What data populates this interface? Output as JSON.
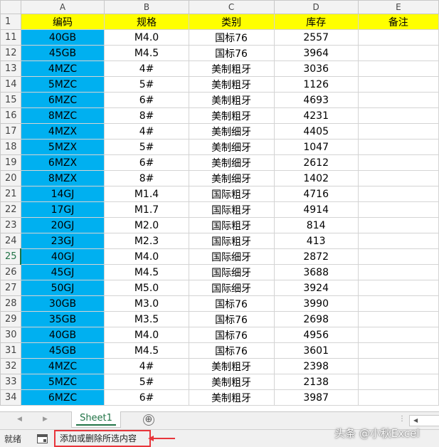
{
  "columns": {
    "a": "A",
    "b": "B",
    "c": "C",
    "d": "D",
    "e": "E"
  },
  "header_row": {
    "row": "1",
    "a": "编码",
    "b": "规格",
    "c": "类别",
    "d": "库存",
    "e": "备注"
  },
  "rows": [
    {
      "row": "11",
      "a": "40GB",
      "b": "M4.0",
      "c": "国标76",
      "d": "2557"
    },
    {
      "row": "12",
      "a": "45GB",
      "b": "M4.5",
      "c": "国标76",
      "d": "3964"
    },
    {
      "row": "13",
      "a": "4MZC",
      "b": "4#",
      "c": "美制粗牙",
      "d": "3036"
    },
    {
      "row": "14",
      "a": "5MZC",
      "b": "5#",
      "c": "美制粗牙",
      "d": "1126"
    },
    {
      "row": "15",
      "a": "6MZC",
      "b": "6#",
      "c": "美制粗牙",
      "d": "4693"
    },
    {
      "row": "16",
      "a": "8MZC",
      "b": "8#",
      "c": "美制粗牙",
      "d": "4231"
    },
    {
      "row": "17",
      "a": "4MZX",
      "b": "4#",
      "c": "美制细牙",
      "d": "4405"
    },
    {
      "row": "18",
      "a": "5MZX",
      "b": "5#",
      "c": "美制细牙",
      "d": "1047"
    },
    {
      "row": "19",
      "a": "6MZX",
      "b": "6#",
      "c": "美制细牙",
      "d": "2612"
    },
    {
      "row": "20",
      "a": "8MZX",
      "b": "8#",
      "c": "美制细牙",
      "d": "1402"
    },
    {
      "row": "21",
      "a": "14GJ",
      "b": "M1.4",
      "c": "国际粗牙",
      "d": "4716"
    },
    {
      "row": "22",
      "a": "17GJ",
      "b": "M1.7",
      "c": "国际粗牙",
      "d": "4914"
    },
    {
      "row": "23",
      "a": "20GJ",
      "b": "M2.0",
      "c": "国际粗牙",
      "d": "814"
    },
    {
      "row": "24",
      "a": "23GJ",
      "b": "M2.3",
      "c": "国际粗牙",
      "d": "413"
    },
    {
      "row": "25",
      "a": "40GJ",
      "b": "M4.0",
      "c": "国际细牙",
      "d": "2872"
    },
    {
      "row": "26",
      "a": "45GJ",
      "b": "M4.5",
      "c": "国际细牙",
      "d": "3688"
    },
    {
      "row": "27",
      "a": "50GJ",
      "b": "M5.0",
      "c": "国际细牙",
      "d": "3924"
    },
    {
      "row": "28",
      "a": "30GB",
      "b": "M3.0",
      "c": "国标76",
      "d": "3990"
    },
    {
      "row": "29",
      "a": "35GB",
      "b": "M3.5",
      "c": "国标76",
      "d": "2698"
    },
    {
      "row": "30",
      "a": "40GB",
      "b": "M4.0",
      "c": "国标76",
      "d": "4956"
    },
    {
      "row": "31",
      "a": "45GB",
      "b": "M4.5",
      "c": "国标76",
      "d": "3601"
    },
    {
      "row": "32",
      "a": "4MZC",
      "b": "4#",
      "c": "美制粗牙",
      "d": "2398"
    },
    {
      "row": "33",
      "a": "5MZC",
      "b": "5#",
      "c": "美制粗牙",
      "d": "2138"
    },
    {
      "row": "34",
      "a": "6MZC",
      "b": "6#",
      "c": "美制粗牙",
      "d": "3987"
    }
  ],
  "active_row": "25",
  "sheet_tab": {
    "label": "Sheet1",
    "add_icon": "⊕"
  },
  "status": {
    "ready": "就绪",
    "message": "添加或删除所选内容"
  },
  "icons": {
    "macro": "macro-record-icon",
    "add_sheet": "plus-circle-icon",
    "arrow": "red-arrow-icon"
  },
  "colors": {
    "header_fill": "#ffff00",
    "code_fill": "#00b0f0",
    "tab_accent": "#217346",
    "callout": "#e8353b"
  },
  "watermark": "头条 @小秋Excel"
}
